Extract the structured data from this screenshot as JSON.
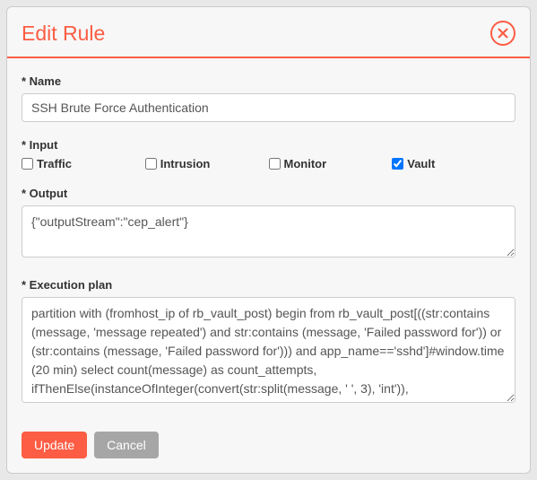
{
  "modal": {
    "title": "Edit Rule"
  },
  "fields": {
    "name": {
      "label": "* Name",
      "value": "SSH Brute Force Authentication"
    },
    "input": {
      "label": "* Input",
      "options": [
        {
          "label": "Traffic",
          "checked": false
        },
        {
          "label": "Intrusion",
          "checked": false
        },
        {
          "label": "Monitor",
          "checked": false
        },
        {
          "label": "Vault",
          "checked": true
        }
      ]
    },
    "output": {
      "label": "* Output",
      "value": "{\"outputStream\":\"cep_alert\"}"
    },
    "execution_plan": {
      "label": "* Execution plan",
      "value": "partition with (fromhost_ip of rb_vault_post) begin from rb_vault_post[((str:contains (message, 'message repeated') and str:contains (message, 'Failed password for')) or (str:contains (message, 'Failed password for'))) and app_name=='sshd']#window.time (20 min) select count(message) as count_attempts, ifThenElse(instanceOfInteger(convert(str:split(message, ' ', 3), 'int')),"
    }
  },
  "footer": {
    "update": "Update",
    "cancel": "Cancel"
  }
}
